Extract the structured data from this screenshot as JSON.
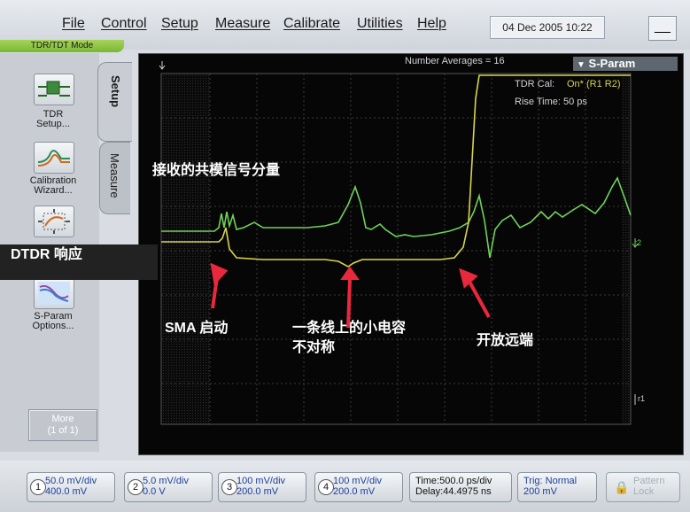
{
  "menu": [
    "File",
    "Control",
    "Setup",
    "Measure",
    "Calibrate",
    "Utilities",
    "Help"
  ],
  "datetime": "04 Dec 2005   10:22",
  "minimize": "__",
  "mode": "TDR/TDT Mode",
  "tabs": {
    "setup": "Setup",
    "measure": "Measure"
  },
  "tools": [
    {
      "label": "TDR\nSetup..."
    },
    {
      "label": "Calibration\nWizard..."
    },
    {
      "label": ""
    },
    {
      "label": "S-Param\nOptions..."
    }
  ],
  "more": "More\n(1 of 1)",
  "display": {
    "number_averages": "Number Averages =   16",
    "sparam": "S-Param",
    "tdr_cal": "TDR Cal:",
    "tdr_cal_value": "On* (R1 R2)",
    "rise_time": "Rise Time:  50 ps",
    "marker_r2": "r2",
    "marker_r1": "r1"
  },
  "annotations": {
    "common_mode": "接收的共模信号分量",
    "dtdr": "DTDR 响应",
    "sma": "SMA 启动",
    "capacitor_line1": "一条线上的小电容",
    "capacitor_line2": "不对称",
    "open_end": "开放远端"
  },
  "channels": [
    {
      "num": "1",
      "line1": "50.0 mV/div",
      "line2": "400.0 mV"
    },
    {
      "num": "2",
      "line1": "5.0 mV/div",
      "line2": "0.0 V"
    },
    {
      "num": "3",
      "line1": "100 mV/div",
      "line2": "200.0 mV"
    },
    {
      "num": "4",
      "line1": "100 mV/div",
      "line2": "200.0 mV"
    }
  ],
  "timebase": {
    "line1": "Time:500.0 ps/div",
    "line2": "Delay:44.4975 ns"
  },
  "trigger": {
    "line1": "Trig: Normal",
    "line2": "200 mV"
  },
  "pattern_lock": {
    "line1": "Pattern",
    "line2": "Lock"
  },
  "colors": {
    "green_trace": "#6fd25a",
    "yellow_trace": "#d9d64a",
    "arrow": "#e8283c",
    "accent_green": "#8cc63f"
  }
}
